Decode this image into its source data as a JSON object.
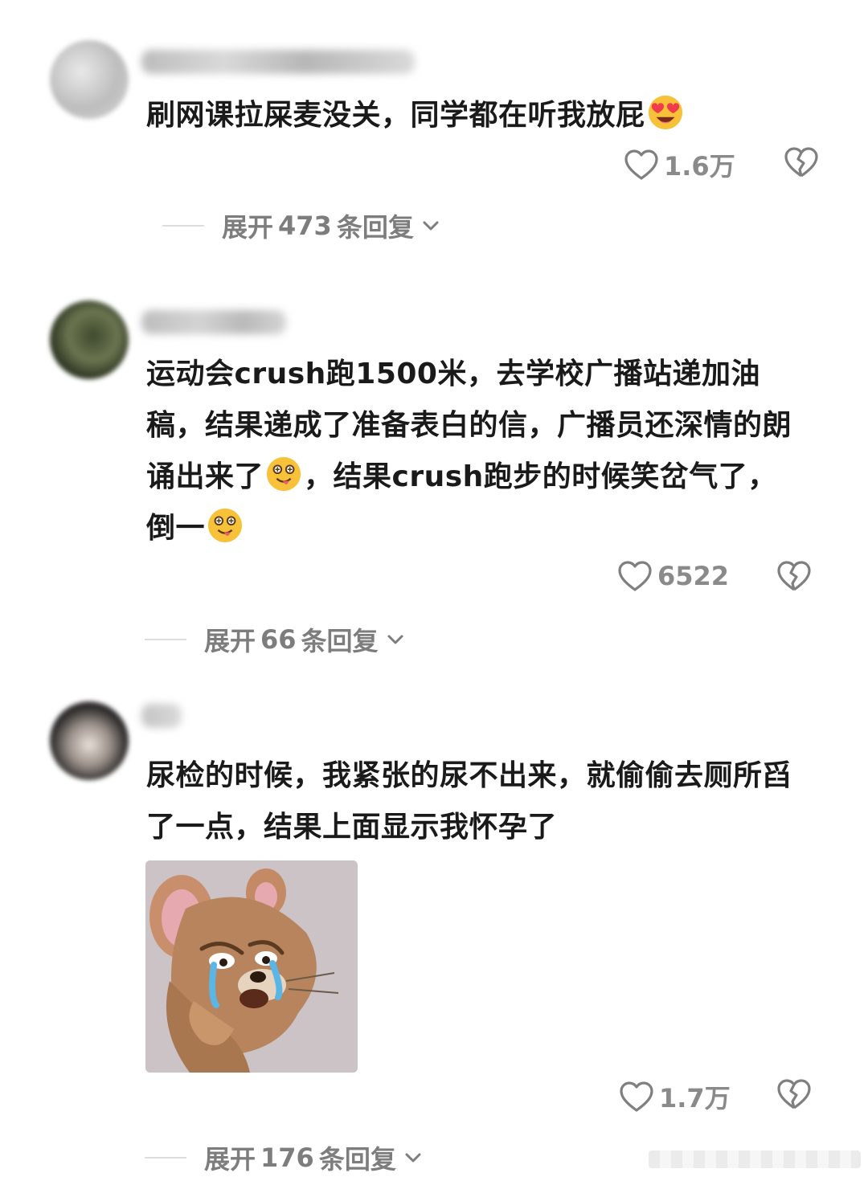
{
  "comments": [
    {
      "text": "刷网课拉屎麦没关，同学都在听我放屁",
      "emoji": "heart-eyes-face",
      "likes": "1.6万",
      "replies_prefix": "展开",
      "replies_count": "473",
      "replies_suffix": "条回复"
    },
    {
      "text_parts": [
        "运动会crush跑1500米，去学校广播站递加油稿，结果递成了准备表白的信，广播员还深情的朗诵出来了",
        "，结果crush跑步的时候笑岔气了，倒一"
      ],
      "emoji": "woozy-tongue-face",
      "likes": "6522",
      "replies_prefix": "展开",
      "replies_count": "66",
      "replies_suffix": "条回复"
    },
    {
      "text": "尿检的时候，我紧张的尿不出来，就偷偷去厕所舀了一点，结果上面显示我怀孕了",
      "sticker": "crying-mouse-sticker",
      "likes": "1.7万",
      "replies_prefix": "展开",
      "replies_count": "176",
      "replies_suffix": "条回复"
    }
  ],
  "colors": {
    "text": "#1a1a1a",
    "muted": "#8a8a8a",
    "background": "#ffffff"
  }
}
